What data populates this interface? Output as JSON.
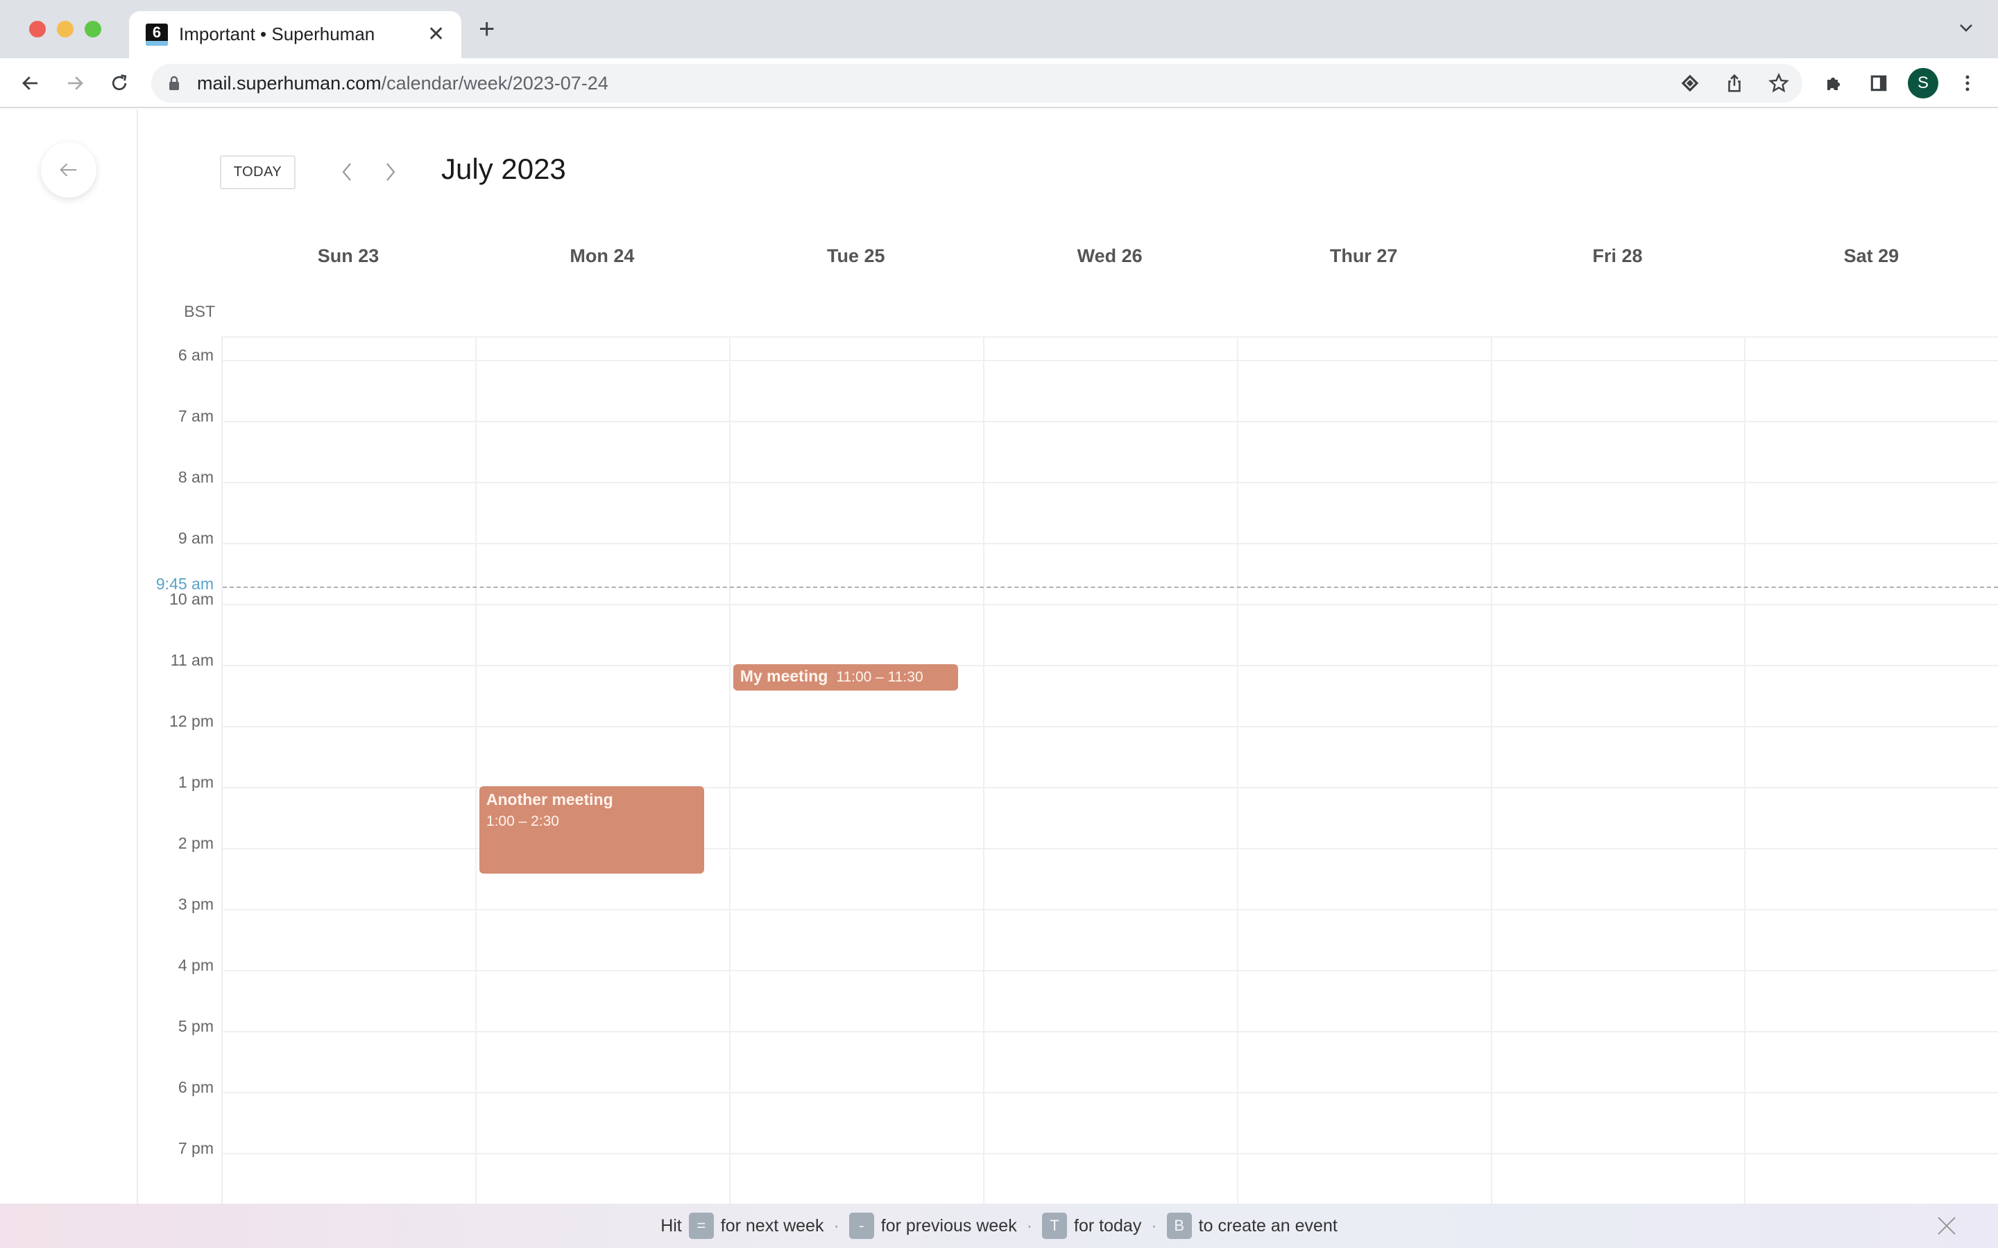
{
  "browser": {
    "tab": {
      "favicon_text": "6",
      "title": "Important • Superhuman"
    },
    "url_host": "mail.superhuman.com",
    "url_path": "/calendar/week/2023-07-24",
    "profile_initial": "S"
  },
  "calendar": {
    "today_label": "TODAY",
    "month_title": "July 2023",
    "timezone": "BST",
    "days": [
      "Sun 23",
      "Mon 24",
      "Tue 25",
      "Wed 26",
      "Thur 27",
      "Fri 28",
      "Sat 29"
    ],
    "hours": [
      "6 am",
      "7 am",
      "8 am",
      "9 am",
      "10 am",
      "11 am",
      "12 pm",
      "1 pm",
      "2 pm",
      "3 pm",
      "4 pm",
      "5 pm",
      "6 pm",
      "7 pm"
    ],
    "now_label": "9:45 am",
    "now_hour": 9.75,
    "events": [
      {
        "title": "My meeting",
        "time": "11:00 – 11:30",
        "day_index": 2,
        "start_hour": 11.0,
        "end_hour": 11.5,
        "layout": "inline"
      },
      {
        "title": "Another meeting",
        "time": "1:00 – 2:30",
        "day_index": 1,
        "start_hour": 13.0,
        "end_hour": 14.5,
        "layout": "stacked"
      }
    ],
    "event_color": "#d48c73"
  },
  "footer": {
    "hit": "Hit",
    "hints": [
      {
        "key": "=",
        "label": "for next week"
      },
      {
        "key": "-",
        "label": "for previous week"
      },
      {
        "key": "T",
        "label": "for today"
      },
      {
        "key": "B",
        "label": "to create an event"
      }
    ]
  }
}
